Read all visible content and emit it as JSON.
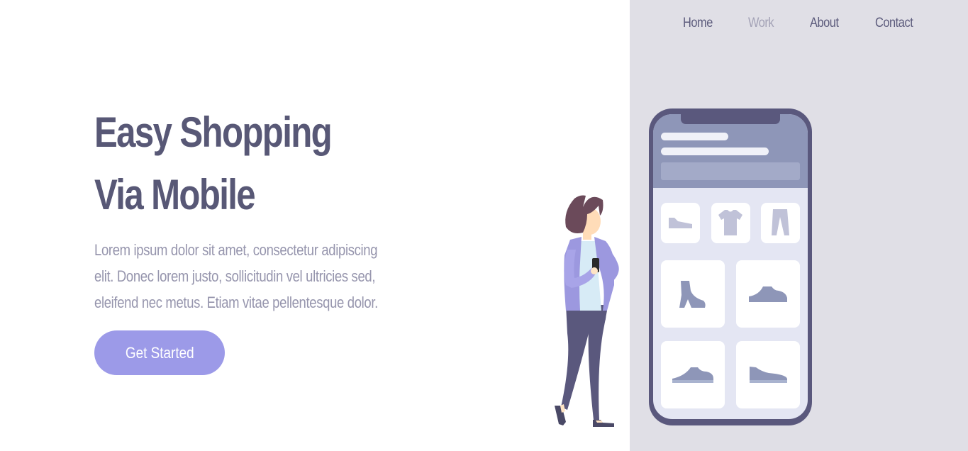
{
  "nav": {
    "items": [
      {
        "label": "Home",
        "active": false
      },
      {
        "label": "Work",
        "active": true
      },
      {
        "label": "About",
        "active": false
      },
      {
        "label": "Contact",
        "active": false
      }
    ]
  },
  "hero": {
    "title_line1": "Easy Shopping",
    "title_line2": "Via Mobile",
    "text_line1": "Lorem ipsum dolor sit amet, consectetur adipiscing",
    "text_line2": "elit. Donec lorem justo, sollicitudin vel ultricies sed,",
    "text_line3": "eleifend nec metus. Etiam vitae pellentesque dolor.",
    "cta_label": "Get Started"
  },
  "colors": {
    "panel_bg": "#e0dfe6",
    "heading": "#585876",
    "body_text": "#9695ad",
    "accent": "#9c9ae8",
    "phone_frame": "#5a587d"
  },
  "illustration": {
    "icons": [
      "woman-figure-icon",
      "smartphone-icon",
      "shoe-icon",
      "tshirt-icon",
      "pants-icon",
      "boot-icon",
      "sneaker-icon"
    ]
  }
}
